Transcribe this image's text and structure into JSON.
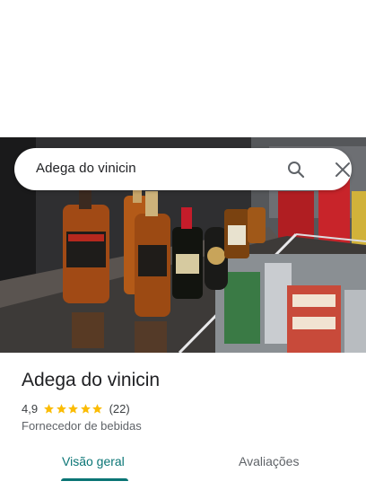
{
  "search": {
    "query": "Adega do vinicin",
    "search_icon": "search-icon",
    "close_icon": "close-icon"
  },
  "hero": {
    "photo": "liquor-bottles-photo"
  },
  "place": {
    "name": "Adega do vinicin",
    "rating": "4,9",
    "stars": 5,
    "review_count": "(22)",
    "category": "Fornecedor de bebidas"
  },
  "tabs": [
    {
      "label": "Visão geral",
      "selected": true
    },
    {
      "label": "Avaliações",
      "selected": false
    }
  ],
  "colors": {
    "accent": "#0a7575",
    "star": "#fbbc04"
  }
}
